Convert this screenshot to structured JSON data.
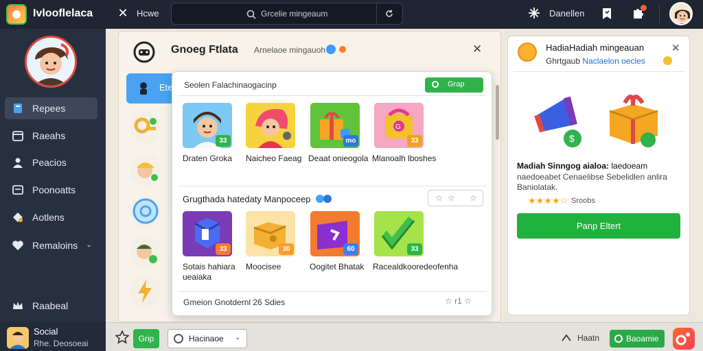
{
  "app": {
    "title": "Ivlooflelaca"
  },
  "topbar": {
    "home_label": "Hcwe",
    "search_placeholder": "Grcelie mingeaum",
    "user_label": "Danellen"
  },
  "sidebar": {
    "items": [
      {
        "label": "Repees",
        "icon": "book-icon",
        "active": true
      },
      {
        "label": "Raeahs",
        "icon": "calendar-icon"
      },
      {
        "label": "Peacios",
        "icon": "person-icon"
      },
      {
        "label": "Poonoatts",
        "icon": "document-icon"
      },
      {
        "label": "Aotlens",
        "icon": "gem-icon"
      },
      {
        "label": "Remaloins",
        "icon": "heart-icon",
        "has_chevron": true
      },
      {
        "label": "Raabeal",
        "icon": "crown-icon"
      }
    ],
    "footer": {
      "title": "Social",
      "subtitle": "Rhe.  Deosoeai"
    }
  },
  "main": {
    "title": "Gnoeg Ftlata",
    "subtitle": "Arnelaoe mingauoh",
    "left_tab_label": "Ete"
  },
  "popup": {
    "search_label": "Seolen Falachinaogacinp",
    "go_button": "Grap",
    "row1": [
      {
        "name": "Draten Groka",
        "badge": "33",
        "badge_color": "#2fb34a"
      },
      {
        "name": "Naicheo Faeag",
        "badge": "",
        "badge_color": ""
      },
      {
        "name": "Deaat onieogola",
        "badge": "mo",
        "badge_color": "#2d78d8"
      },
      {
        "name": "Mlanoalh lboshes",
        "badge": "33",
        "badge_color": "#f1a21c"
      }
    ],
    "section_title": "Grugthada hatedaty Manpoceep",
    "rating_stars": [
      "☆",
      "☆",
      "☆"
    ],
    "row2": [
      {
        "name": "Sotais hahiara ueaiaka",
        "badge": "33",
        "badge_color": "#ff7a2d"
      },
      {
        "name": "Moocisee",
        "badge": "30",
        "badge_color": "#ff9a2d"
      },
      {
        "name": "Oogitet Bhatak",
        "badge": "60",
        "badge_color": "#3c7dff"
      },
      {
        "name": "Racealdkooredeofenha",
        "badge": "33",
        "badge_color": "#2fb34a"
      }
    ],
    "footer_text": "Gmeion  Gnotdernl  26 Sdies",
    "footer_stars": "☆ r1  ☆"
  },
  "right_panel": {
    "title": "HadiaHadiah mingeauan",
    "subtitle_plain": "Ghrtgaub",
    "subtitle_blue": "Naclaelon oecles",
    "desc_title_bold": "Madiah Sinngog aialoa:",
    "desc_title_rest": "laedoeam",
    "desc": "naedoeabet Cenaelibse Sebelidlen anlira Baniolatak.",
    "rating_label": "Sroobs",
    "cta": "Panp Eltert"
  },
  "bottombar": {
    "go_label": "Grip",
    "select_value": "Hacinaoe",
    "home_label": "Haatn",
    "button_label": "Baoamie"
  },
  "colors": {
    "accent_green": "#2fb34a",
    "sidebar_bg": "#283040",
    "topbar_bg": "#1f2632",
    "accent_blue": "#4aa3f2"
  }
}
